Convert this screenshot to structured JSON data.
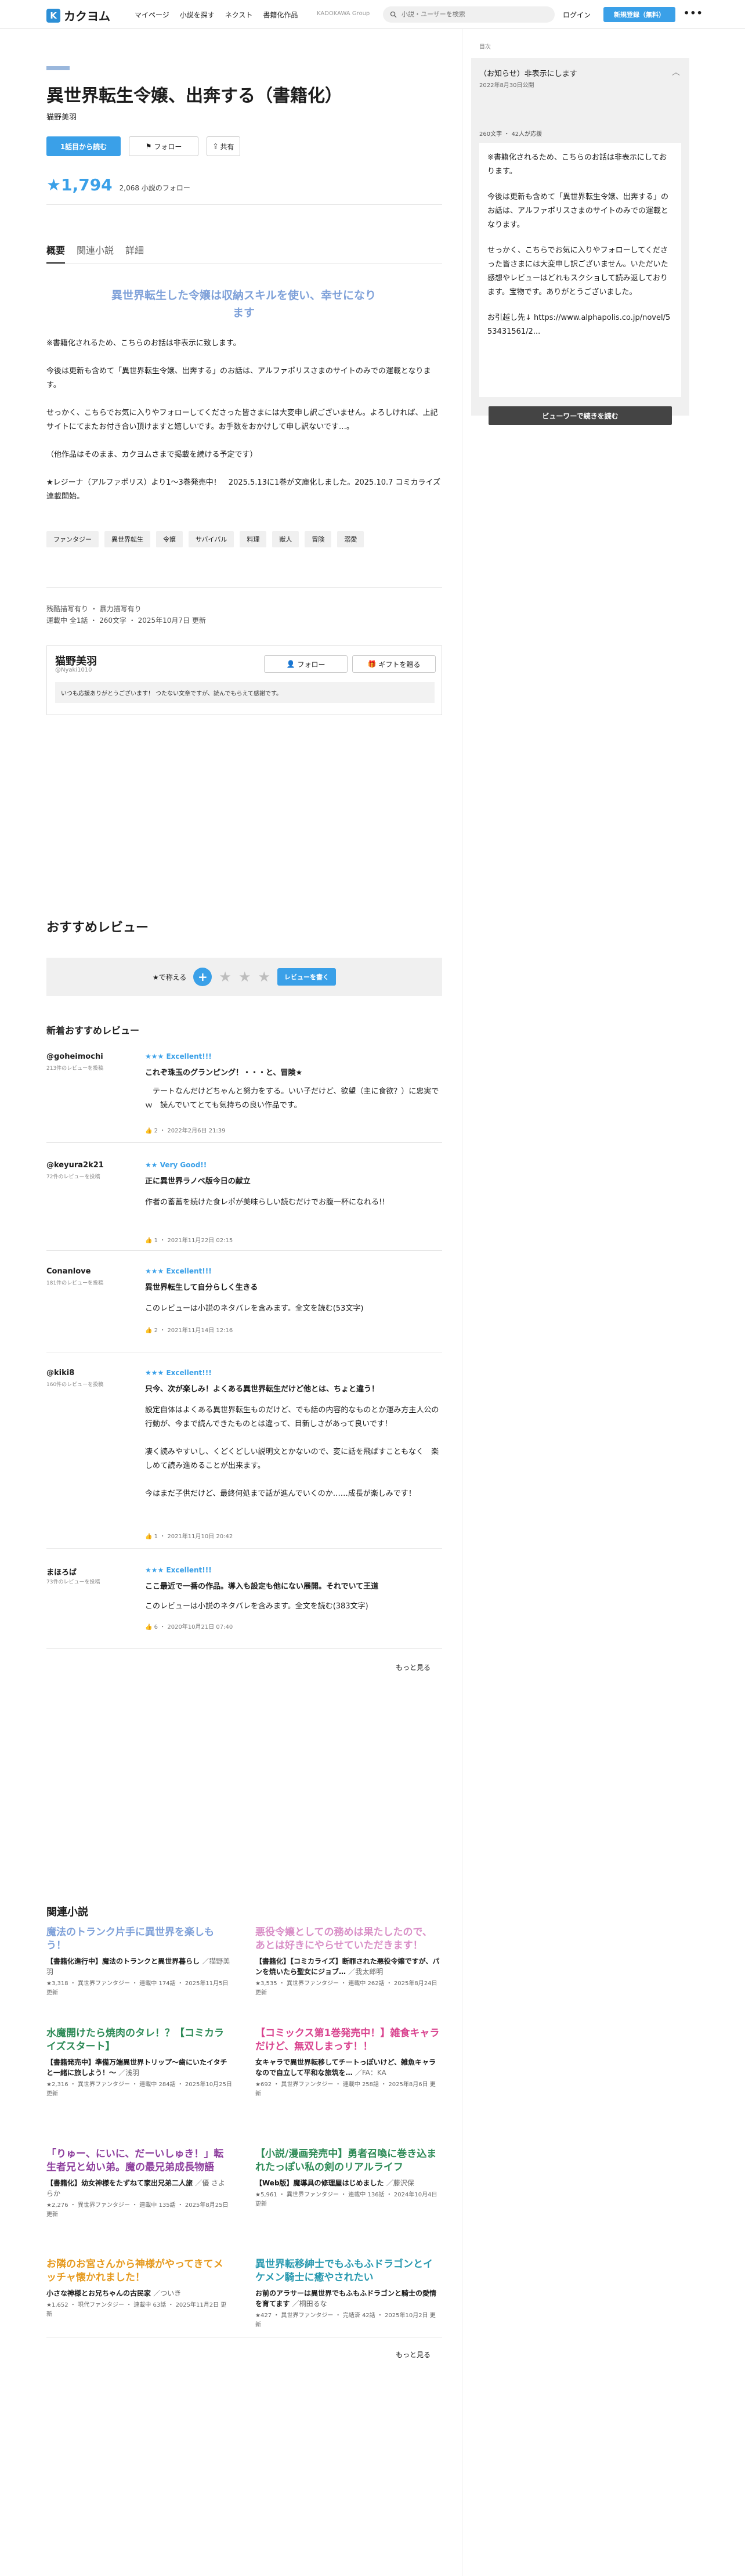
{
  "header": {
    "logo_text": "カクヨム",
    "nav": [
      "マイページ",
      "小説を探す",
      "ネクスト",
      "書籍化作品"
    ],
    "kadokawa": "KADOKAWA Group",
    "search_placeholder": "小説・ユーザーを検索",
    "login": "ログイン",
    "register": "新規登録（無料）"
  },
  "work": {
    "title": "異世界転生令嬢、出奔する（書籍化）",
    "author": "猫野美羽",
    "read_button": "1話目から読む",
    "follow_button": "フォロー",
    "share_button": "共有",
    "stars": "★1,794",
    "followers": "2,068 小説のフォロー"
  },
  "tabs": [
    "概要",
    "関連小説",
    "詳細"
  ],
  "catchphrase": "異世界転生した令嬢は収納スキルを使い、幸せになります",
  "intro": [
    "※書籍化されるため、こちらのお話は非表示に致します。",
    "今後は更新も含めて「異世界転生令嬢、出奔する」のお話は、アルファポリスさまのサイトのみでの運載となります。",
    "せっかく、こちらでお気に入りやフォローしてくださった皆さまには大変申し訳ございません。よろしければ、上記サイトにてまたお付き合い頂けますと嬉しいです。お手数をおかけして申し訳ないです…。",
    "（他作品はそのまま、カクヨムさまで掲載を続ける予定です）",
    "★レジーナ（アルファポリス）より1〜3巻発売中！　2025.5.13に1巻が文庫化しました。2025.10.7 コミカライズ連載開始。"
  ],
  "tags": [
    "ファンタジー",
    "異世界転生",
    "令嬢",
    "サバイバル",
    "料理",
    "獣人",
    "冒険",
    "溺愛"
  ],
  "meta1": "残酷描写有り ・ 暴力描写有り",
  "meta2": "運載中 全1話 ・ 260文字 ・ 2025年10月7日 更新",
  "author_card": {
    "name": "猫野美羽",
    "id": "@Nyaki1010",
    "follow": "フォロー",
    "gift": "ギフトを贈る",
    "message": "いつも応援ありがとうございます！ つたない文章ですが、読んでもらえて感謝です。"
  },
  "reviews_section": {
    "title": "おすすめレビュー",
    "rate_label": "★で称える",
    "rate_plus": "+",
    "rate_button": "レビューを書く",
    "new_title": "新着おすすめレビュー",
    "more": "もっと見る"
  },
  "reviews": [
    {
      "user": "@goheimochi",
      "sub": "213件のレビューを投稿",
      "rating": "★★★ Excellent!!!",
      "title": "これぞ珠玉のグランピング！・・・と、冒険★",
      "body": "　テートなんだけどちゃんと努力をする。いい子だけど、欲望（主に食欲？）に忠実でｗ　読んでいてとても気持ちの良い作品です。",
      "meta": "👍 2 ・ 2022年2月6日 21:39"
    },
    {
      "user": "@keyura2k21",
      "sub": "72件のレビューを投稿",
      "rating": "★★ Very Good!!",
      "title": "正に異世界ラノベ版今日の献立",
      "body": "作者の蓄蓄を続けた食レポが美味らしい読むだけでお腹一杯になれる!!",
      "meta": "👍 1 ・ 2021年11月22日 02:15"
    },
    {
      "user": "Conanlove",
      "sub": "181件のレビューを投稿",
      "rating": "★★★ Excellent!!!",
      "title": "異世界転生して自分らしく生きる",
      "body": "このレビューは小説のネタバレを含みます。全文を読む(53文字)",
      "meta": "👍 2 ・ 2021年11月14日 12:16"
    },
    {
      "user": "@kiki8",
      "sub": "160件のレビューを投稿",
      "rating": "★★★ Excellent!!!",
      "title": "只今、次が楽しみ！よくある異世界転生だけど他とは、ちょと違う！",
      "body": "設定自体はよくある異世界転生ものだけど、でも話の内容的なものとか運み方主人公の行動が、今まで読んできたものとは違って、目新しさがあって良いです！\n\n凄く読みやすいし、くどくどしい説明文とかないので、変に話を飛ばすこともなく　楽しめて読み進めることが出来ます。\n\n今はまだ子供だけど、最終何処まで話が進んでいくのか……成長が楽しみです！",
      "meta": "👍 1 ・ 2021年11月10日 20:42"
    },
    {
      "user": "まほろば",
      "sub": "73件のレビューを投稿",
      "rating": "★★★ Excellent!!!",
      "title": "ここ最近で一番の作品。導入も設定も他にない展開。それでいて王道",
      "body": "このレビューは小説のネタバレを含みます。全文を読む(383文字)",
      "meta": "👍 6 ・ 2020年10月21日 07:40"
    }
  ],
  "related": {
    "title": "関連小説",
    "more": "もっと見る",
    "items": [
      {
        "title": "魔法のトランク片手に異世界を楽しもう！",
        "color": "#7fa1d9",
        "desc": "【書籍化進行中】魔法のトランクと異世界暮らし",
        "author": "／猫野美羽",
        "meta": "★3,318 ・ 異世界ファンタジー ・ 連載中 174話 ・ 2025年11月5日 更新"
      },
      {
        "title": "悪役令嬢としての務めは果たしたので、あとは好きにやらせていただきます！",
        "color": "#d98fc7",
        "desc": "【書籍化】【コミカライズ】断罪された悪役令嬢ですが、パンを焼いたら聖女にジョブ…",
        "author": "／我太郎明",
        "meta": "★3,535 ・ 異世界ファンタジー ・ 連載中 262話 ・ 2025年8月24日 更新"
      },
      {
        "title": "水魔開けたら焼肉のタレ！？【コミカライズスタート】",
        "color": "#2e8b57",
        "desc": "【書籍発売中】準備万端異世界トリップ〜歯にいたイタチと一緒に旅しよう！〜",
        "author": "／浅羽",
        "meta": "★2,316 ・ 異世界ファンタジー ・ 連載中 284話 ・ 2025年10月25日 更新"
      },
      {
        "title": "【コミックス第1巻発売中！】雑食キャラだけど、無双しまっす！！",
        "color": "#d9448f",
        "desc": "女キャラで異世界転移してチートっぽいけど、雑魚キャラなので自立して平和な旅筑を…",
        "author": "／FA：KA",
        "meta": "★692 ・ 異世界ファンタジー ・ 連載中 258話 ・ 2025年8月6日 更新"
      },
      {
        "title": "「りゅー、にいに、だーいしゅき！」転生者兄と幼い弟。魔の最兄弟成長物語",
        "color": "#8e3f9e",
        "desc": "【書籍化】幼女神様をたずねて家出兄弟二人旅",
        "author": "／優 さよらか",
        "meta": "★2,276 ・ 異世界ファンタジー ・ 連載中 135話 ・ 2025年8月25日 更新"
      },
      {
        "title": "【小説/漫画発売中】勇者召喚に巻き込まれたっぽい私の剣のリアルライフ",
        "color": "#2e8b57",
        "desc": "【Web版】魔導具の修理屋はじめました",
        "author": "／藤沢保",
        "meta": "★5,961 ・ 異世界ファンタジー ・ 連載中 136話 ・ 2024年10月4日 更新"
      },
      {
        "title": "お隣のお宮さんから神様がやってきてメッチャ懐かれました！",
        "color": "#e69a1e",
        "desc": "小さな神様とお兄ちゃんの古民家",
        "author": "／ついき",
        "meta": "★1,652 ・ 現代ファンタジー ・ 連載中 63話 ・ 2025年11月2日 更新"
      },
      {
        "title": "異世界転移紳士でもふもふドラゴンとイケメン騎士に癒やされたい",
        "color": "#2a9ab0",
        "desc": "お前のアラサーは異世界でもふもふドラゴンと騎士の愛情を育てます",
        "author": "／桐田るな",
        "meta": "★427 ・ 異世界ファンタジー ・ 完結済 42話 ・ 2025年10月2日 更新"
      }
    ]
  },
  "sidebar": {
    "label": "目次",
    "notice_title": "（お知らせ）非表示にします",
    "notice_date": "2022年8月30日公開",
    "meta": "260文字 ・ 42人が応援",
    "body": [
      "※書籍化されるため、こちらのお話は非表示にしております。",
      "今後は更新も含めて「異世界転生令嬢、出奔する」のお話は、アルファポリスさまのサイトのみでの運載となります。",
      "せっかく、こちらでお気に入りやフォローしてくださった皆さまには大変申し訳ございません。いただいた感想やレビューはどれもスクショして読み返しております。宝物です。ありがとうございました。",
      "お引越し先↓ https://www.alphapolis.co.jp/novel/553431561/2..."
    ],
    "button": "ビューワーで続きを読む"
  },
  "colors": {
    "accent": "#3aa0e8",
    "catch": "#7fa1d9"
  }
}
